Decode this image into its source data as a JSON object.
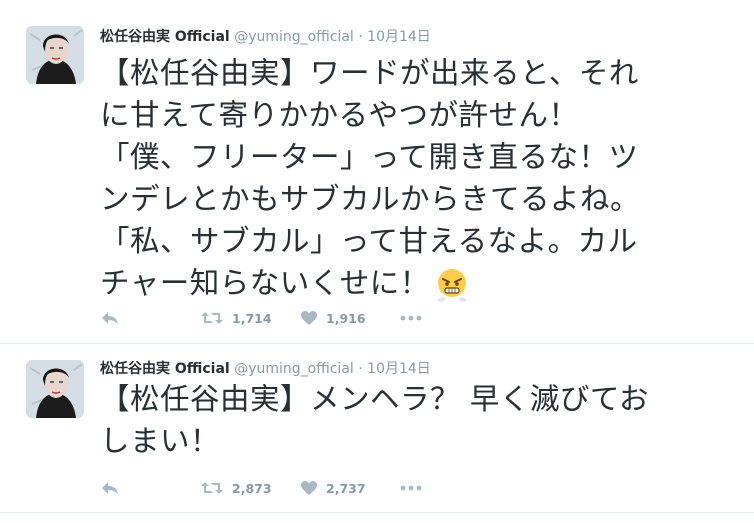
{
  "tweets": [
    {
      "fullname": "松任谷由実 Official",
      "handle": "@yuming_official",
      "separator": "·",
      "date": "10月14日",
      "lines": [
        "【松任谷由実】ワードが出来ると、それ",
        "に甘えて寄りかかるやつが許せん！",
        "「僕、フリーター」って開き直るな！ツ",
        "ンデレとかもサブカルからきてるよね。",
        "「私、サブカル」って甘えるなよ。カル",
        "チャー知らないくせに！"
      ],
      "emoji": "angry-face-emoji",
      "retweets": "1,714",
      "likes": "1,916"
    },
    {
      "fullname": "松任谷由実 Official",
      "handle": "@yuming_official",
      "separator": "·",
      "date": "10月14日",
      "lines": [
        "【松任谷由実】メンヘラ？ 早く滅びてお",
        "しまい！"
      ],
      "retweets": "2,873",
      "likes": "2,737"
    }
  ],
  "icons": {
    "reply": "reply-icon",
    "retweet": "retweet-icon",
    "like": "heart-icon",
    "more": "more-dots-icon"
  },
  "colors": {
    "text": "#292f33",
    "meta": "#8899a6",
    "border": "#e1e8ed",
    "action_icon": "#aab8c2"
  }
}
